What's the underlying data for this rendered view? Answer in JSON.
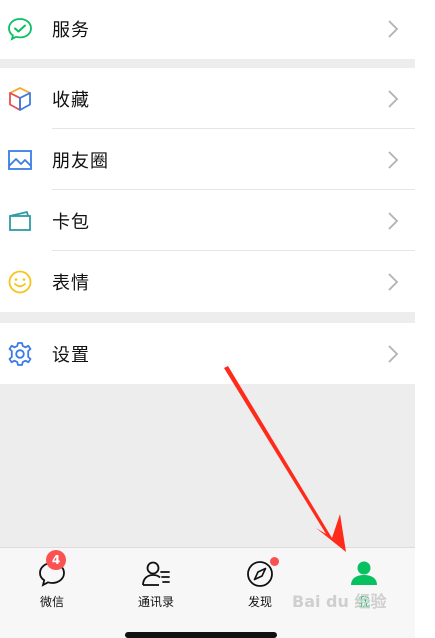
{
  "menu": {
    "service_label": "服务",
    "group2": [
      "收藏",
      "朋友圈",
      "卡包",
      "表情"
    ],
    "settings_label": "设置"
  },
  "tabbar": {
    "chats_label": "微信",
    "chats_badge": "4",
    "contacts_label": "通讯录",
    "discover_label": "发现",
    "me_label": "我"
  },
  "watermark": "Bai du 经验",
  "colors": {
    "green": "#07c160",
    "badge_red": "#fa5151",
    "arrow_red": "#ff2a1a",
    "separator": "#ededed"
  }
}
